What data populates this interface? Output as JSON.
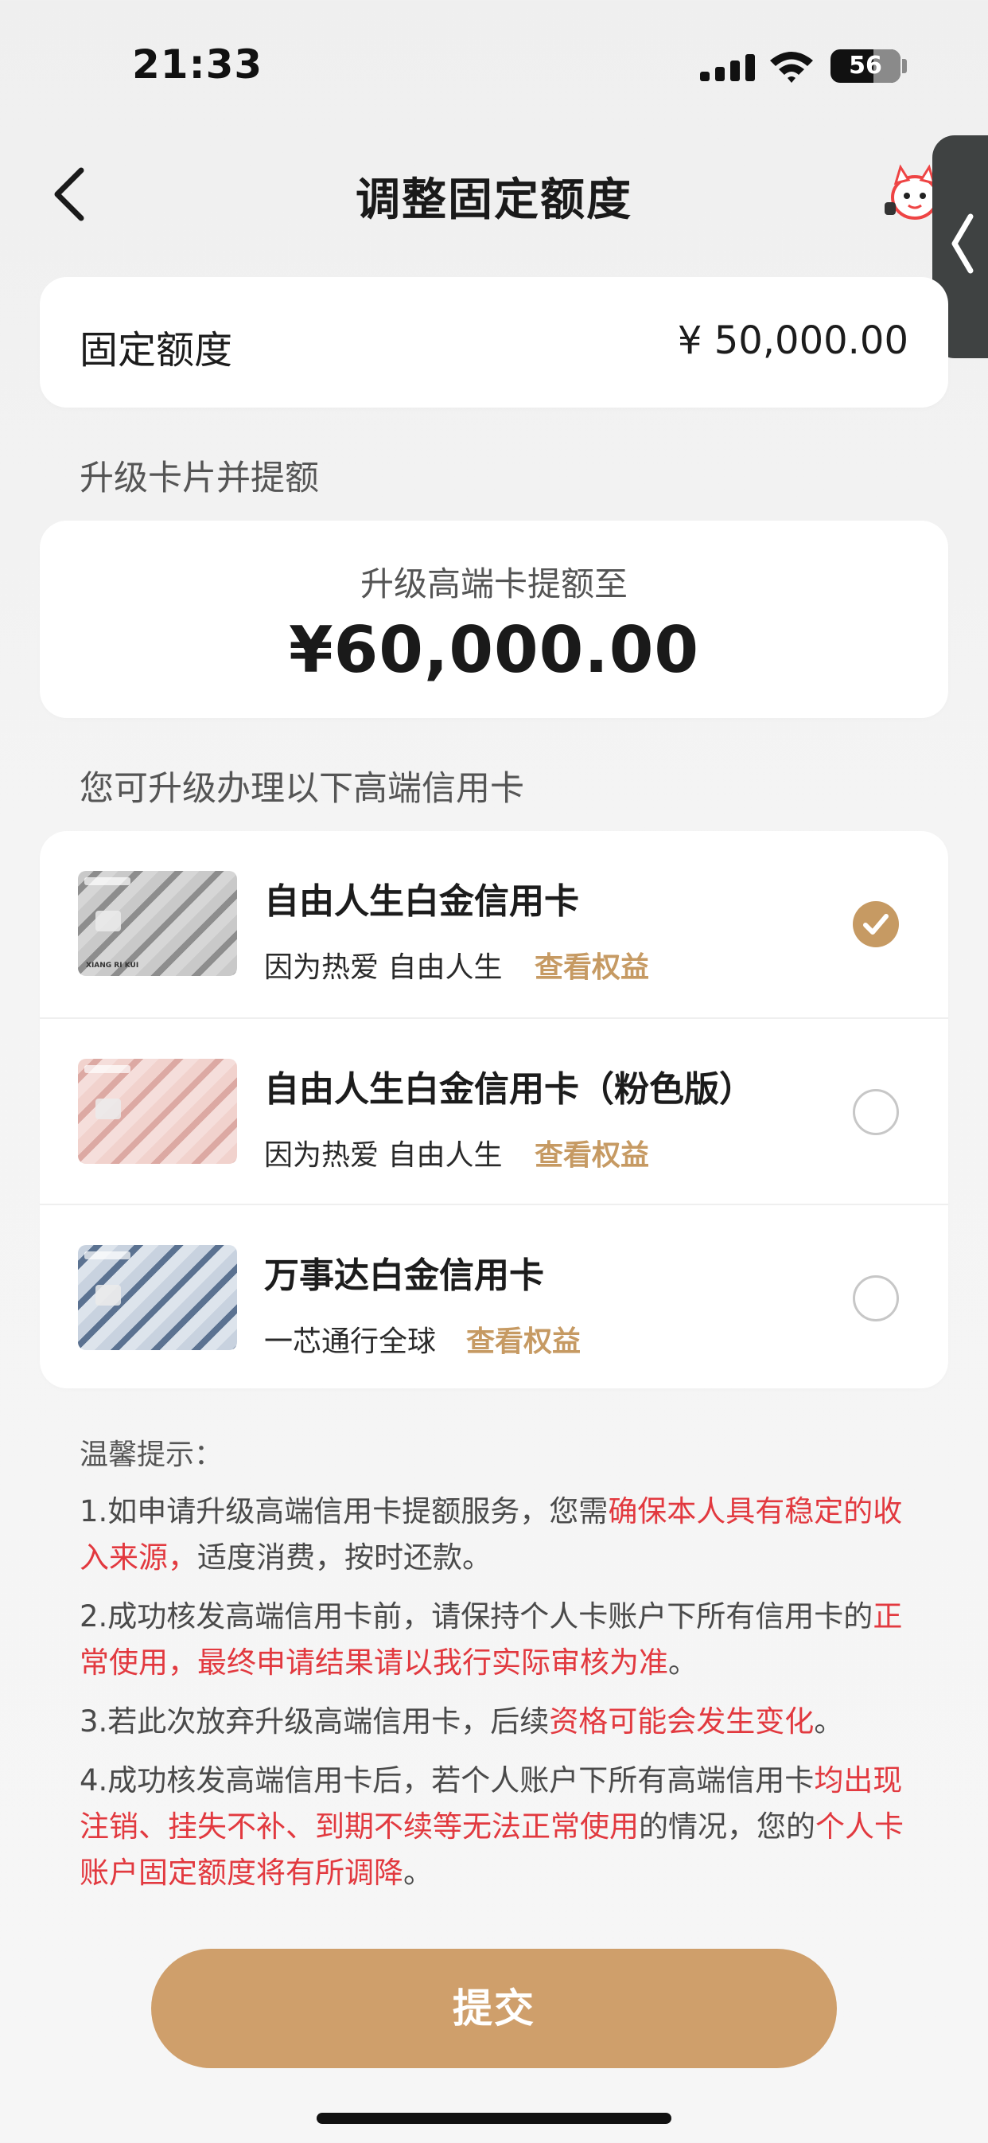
{
  "status_bar": {
    "time": "21:33",
    "battery": "56"
  },
  "header": {
    "title": "调整固定额度"
  },
  "fixed_limit": {
    "label": "固定额度",
    "value": "¥ 50,000.00"
  },
  "upgrade": {
    "section_label": "升级卡片并提额",
    "subtitle": "升级高端卡提额至",
    "amount": "¥60,000.00"
  },
  "cards": {
    "section_label": "您可升级办理以下高端信用卡",
    "link_label": "查看权益",
    "items": [
      {
        "name": "自由人生白金信用卡",
        "desc": "因为热爱 自由人生",
        "selected": true
      },
      {
        "name": "自由人生白金信用卡（粉色版）",
        "desc": "因为热爱 自由人生",
        "selected": false
      },
      {
        "name": "万事达白金信用卡",
        "desc": "一芯通行全球",
        "selected": false
      }
    ]
  },
  "tips": {
    "title": "温馨提示：",
    "t1a": "1.如申请升级高端信用卡提额服务，您需",
    "t1b": "确保本人具有稳定的收入来源，",
    "t1c": "适度消费，按时还款。",
    "t2a": "2.成功核发高端信用卡前，请保持个人卡账户下所有信用卡的",
    "t2b": "正常使用，最终申请结果请以我行实际审核为准",
    "t2c": "。",
    "t3a": "3.若此次放弃升级高端信用卡，后续",
    "t3b": "资格可能会发生变化",
    "t3c": "。",
    "t4a": "4.成功核发高端信用卡后，若个人账户下所有高端信用卡",
    "t4b": "均出现注销、挂失不补、到期不续等无法正常使用",
    "t4c": "的情况，您的",
    "t4d": "个人卡账户固定额度将有所调降",
    "t4e": "。"
  },
  "submit_label": "提交",
  "colors": {
    "accent": "#c69a63",
    "warning": "#e2393f",
    "button": "#cf9f6b"
  },
  "icons": {
    "back": "chevron-left-icon",
    "mascot": "mascot-icon",
    "side_tab": "chevron-left-icon",
    "selected": "check-icon"
  }
}
